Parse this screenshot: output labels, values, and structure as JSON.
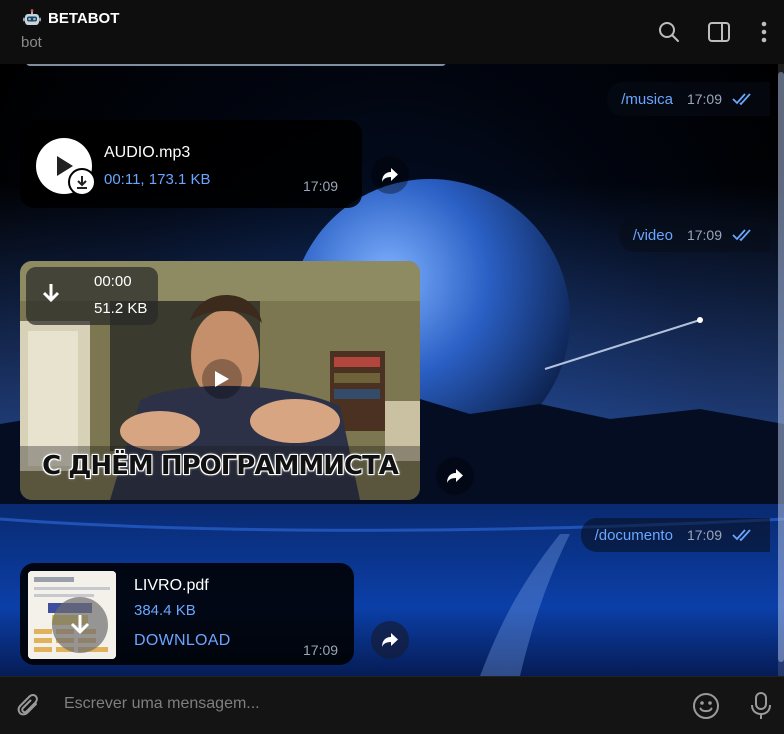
{
  "header": {
    "title": "BETABOT",
    "status": "bot",
    "icons": [
      "search-icon",
      "sidebar-toggle-icon",
      "more-vertical-icon"
    ]
  },
  "messages": [
    {
      "type": "command",
      "text": "/musica",
      "time": "17:09",
      "read": true
    },
    {
      "type": "audio",
      "file_name": "AUDIO.mp3",
      "meta": "00:11, 173.1 KB",
      "time": "17:09"
    },
    {
      "type": "command",
      "text": "/video",
      "time": "17:09",
      "read": true
    },
    {
      "type": "video",
      "duration": "00:00",
      "size": "51.2 KB",
      "caption": "С ДНЁМ ПРОГРАММИСТА"
    },
    {
      "type": "command",
      "text": "/documento",
      "time": "17:09",
      "read": true
    },
    {
      "type": "document",
      "file_name": "LIVRO.pdf",
      "size": "384.4 KB",
      "action": "DOWNLOAD",
      "time": "17:09"
    }
  ],
  "composer": {
    "placeholder": "Escrever uma mensagem...",
    "icons": [
      "attach-icon",
      "emoji-icon",
      "microphone-icon"
    ]
  },
  "colors": {
    "accent": "#6aa6ff",
    "header_bg": "#0e0e0e",
    "composer_bg": "#141414",
    "bubble_bg": "#000000"
  }
}
